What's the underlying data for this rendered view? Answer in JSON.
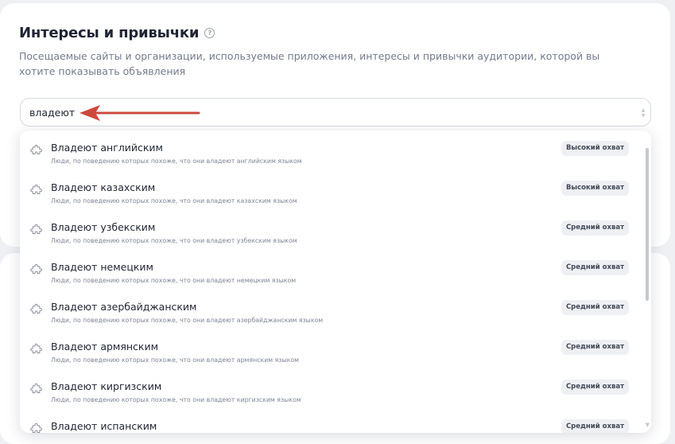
{
  "section": {
    "title": "Интересы и привычки",
    "help_icon": "question-circle-icon",
    "subtitle": "Посещаемые сайты и организации, используемые приложения, интересы и привычки аудитории, которой вы хотите показывать объявления"
  },
  "search": {
    "value": "владеют",
    "placeholder": ""
  },
  "annotation": {
    "arrow_color": "#cc4a3d",
    "arrow_icon": "red-arrow-annotation"
  },
  "dropdown": {
    "items": [
      {
        "title": "Владеют английским",
        "desc": "Люди, по поведению которых похоже, что они владеют английским языком",
        "badge": "Высокий охват"
      },
      {
        "title": "Владеют казахским",
        "desc": "Люди, по поведению которых похоже, что они владеют казахским языком",
        "badge": "Высокий охват"
      },
      {
        "title": "Владеют узбекским",
        "desc": "Люди, по поведению которых похоже, что они владеют узбекским языком",
        "badge": "Средний охват"
      },
      {
        "title": "Владеют немецким",
        "desc": "Люди, по поведению которых похоже, что они владеют немецким языком",
        "badge": "Средний охват"
      },
      {
        "title": "Владеют азербайджанским",
        "desc": "Люди, по поведению которых похоже, что они владеют азербайджанским языком",
        "badge": "Средний охват"
      },
      {
        "title": "Владеют армянским",
        "desc": "Люди, по поведению которых похоже, что они владеют армянским языком",
        "badge": "Средний охват"
      },
      {
        "title": "Владеют киргизским",
        "desc": "Люди, по поведению которых похоже, что они владеют киргизским языком",
        "badge": "Средний охват"
      },
      {
        "title": "Владеют испанским",
        "desc": "",
        "badge": "Средний охват"
      }
    ],
    "item_icon": "puzzle-icon"
  }
}
